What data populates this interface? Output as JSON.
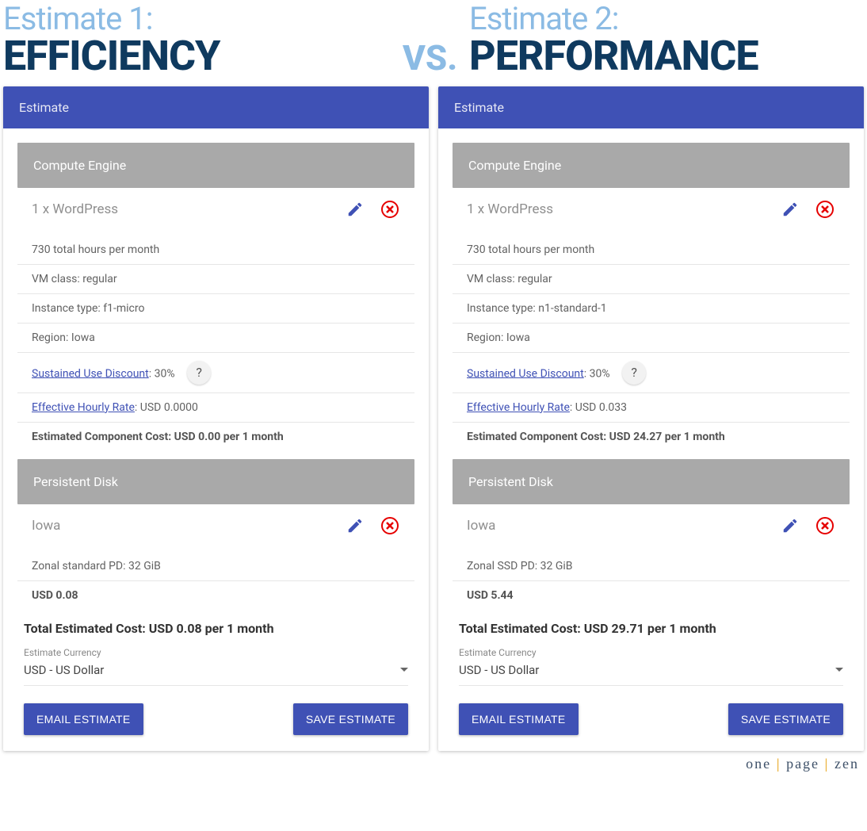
{
  "header": {
    "left_small": "Estimate 1:",
    "left_big": "EFFICIENCY",
    "vs": "VS.",
    "right_small": "Estimate 2:",
    "right_big": "PERFORMANCE"
  },
  "footer": {
    "one": "one",
    "page": "page",
    "zen": "zen"
  },
  "common": {
    "estimate_header": "Estimate",
    "compute_header": "Compute Engine",
    "disk_header": "Persistent Disk",
    "email_btn": "EMAIL ESTIMATE",
    "save_btn": "SAVE ESTIMATE",
    "currency_label": "Estimate Currency",
    "currency_value": "USD - US Dollar",
    "help_icon": "?"
  },
  "estimates": [
    {
      "resource_title": "1 x WordPress",
      "hours": "730 total hours per month",
      "vm_class": "VM class: regular",
      "instance_type": "Instance type: f1-micro",
      "region": "Region: Iowa",
      "sud_label": "Sustained Use Discount",
      "sud_value": ": 30%",
      "ehr_label": "Effective Hourly Rate",
      "ehr_value": ": USD 0.0000",
      "component_cost": "Estimated Component Cost: USD 0.00 per 1 month",
      "disk_region": "Iowa",
      "disk_desc": "Zonal standard PD: 32 GiB",
      "disk_cost": "USD 0.08",
      "total": "Total Estimated Cost: USD 0.08 per 1 month"
    },
    {
      "resource_title": "1 x WordPress",
      "hours": "730 total hours per month",
      "vm_class": "VM class: regular",
      "instance_type": "Instance type: n1-standard-1",
      "region": "Region: Iowa",
      "sud_label": "Sustained Use Discount",
      "sud_value": ": 30%",
      "ehr_label": "Effective Hourly Rate",
      "ehr_value": ": USD 0.033",
      "component_cost": "Estimated Component Cost: USD 24.27 per 1 month",
      "disk_region": "Iowa",
      "disk_desc": "Zonal SSD PD: 32 GiB",
      "disk_cost": "USD 5.44",
      "total": "Total Estimated Cost: USD 29.71 per 1 month"
    }
  ]
}
